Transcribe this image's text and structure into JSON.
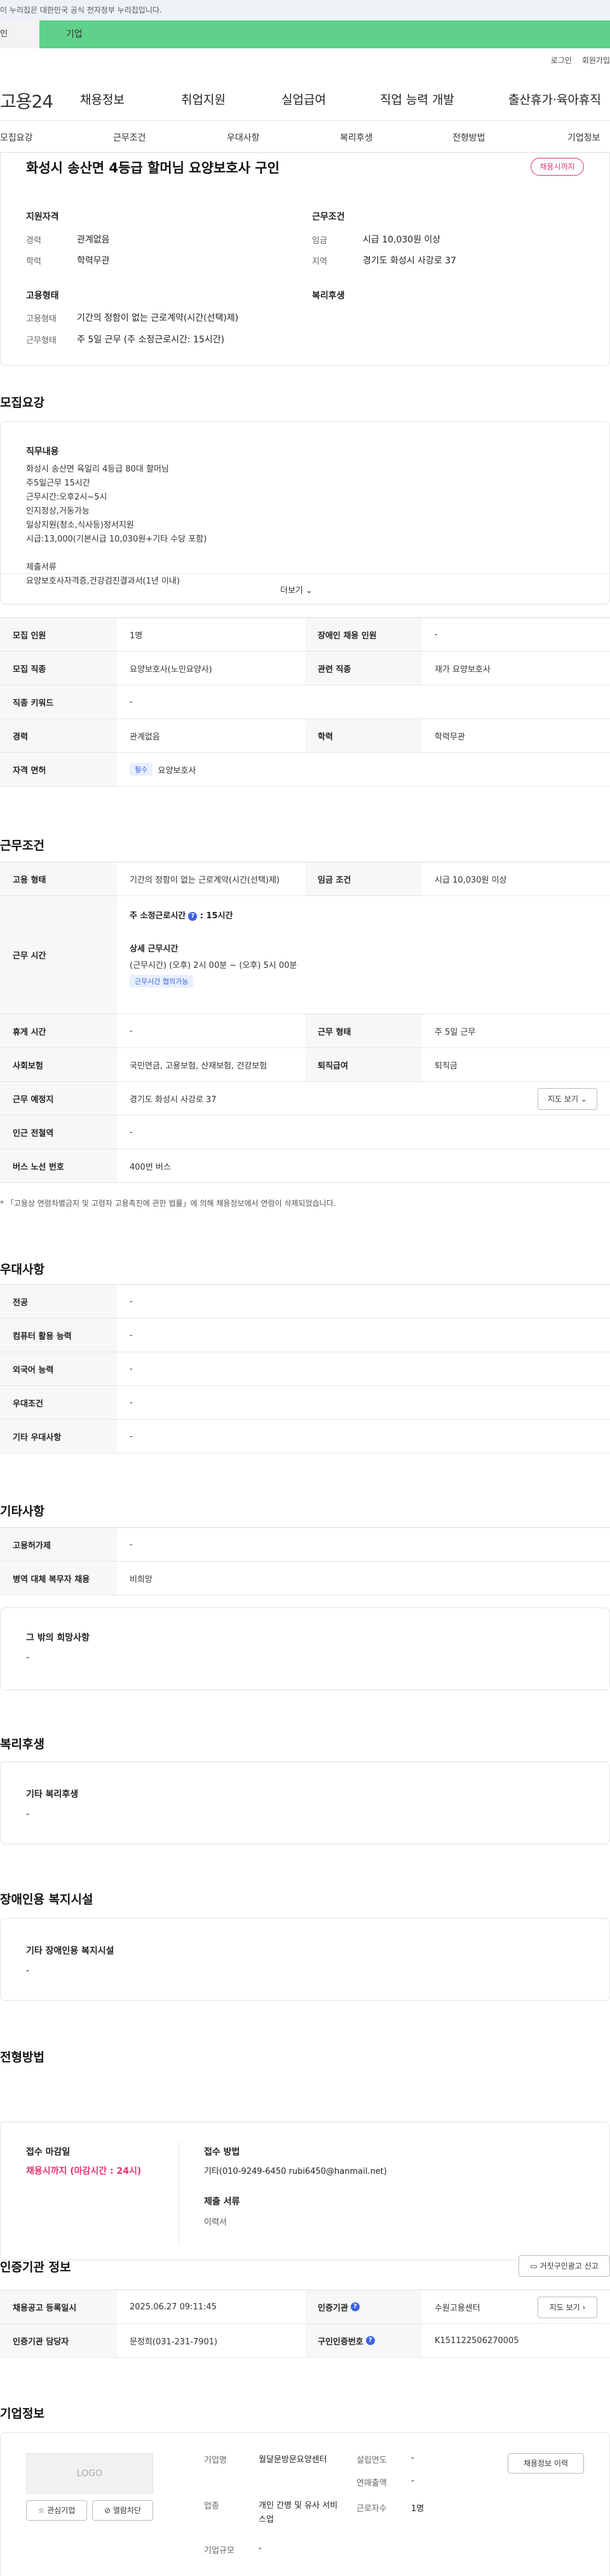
{
  "gov_banner": "이 누리집은 대한민국 공식 전자정부 누리집입니다.",
  "tabs": {
    "individual": "인",
    "company": "기업"
  },
  "util": {
    "login": "로그인",
    "join": "회원가입"
  },
  "logo": "고용24",
  "gnb": [
    "채용정보",
    "취업지원",
    "실업급여",
    "직업 능력 개발",
    "출산휴가·육아휴직"
  ],
  "snb": [
    "모집요강",
    "근무조건",
    "우대사항",
    "복리후생",
    "전형방법",
    "기업정보"
  ],
  "job": {
    "title": "화성시 송산면 4등급 할머님 요양보호사 구인",
    "deadline_badge": "채용시까지",
    "qual_title": "지원자격",
    "career_lbl": "경력",
    "career_val": "관계없음",
    "edu_lbl": "학력",
    "edu_val": "학력무관",
    "cond_title": "근무조건",
    "wage_lbl": "임금",
    "wage_val": "시급 10,030원 이상",
    "area_lbl": "지역",
    "area_val": "경기도 화성시 사강로 37",
    "emp_title": "고용형태",
    "emp_lbl": "고용형태",
    "emp_val": "기간의 정함이 없는 근로계약(시간(선택)제)",
    "work_lbl": "근무형태",
    "work_val": "주 5일 근무 (주 소정근로시간: 15시간)",
    "welfare_title": "복리후생"
  },
  "recruit": {
    "section": "모집요강",
    "duty_title": "직무내용",
    "duty_lines": [
      "화성시 송산면 육일리 4등급 80대 할머님",
      "주5일근무 15시간",
      "근무시간:오후2시~5시",
      "인지정상,거동가능",
      "일상지원(청소,식사등)정서지원",
      "시급:13,000(기본시급 10,030원+기타 수당 포함)",
      "",
      "제출서류",
      "요양보호사자격증,건강검진결과서(1년 이내)"
    ],
    "more": "더보기",
    "rows": [
      {
        "h1": "모집 인원",
        "v1": "1명",
        "h2": "장애인 채용 인원",
        "v2": "-"
      },
      {
        "h1": "모집 직종",
        "v1": "요양보호사(노인요양사)",
        "h2": "관련 직종",
        "v2": "재가 요양보호사"
      },
      {
        "h1": "직종 키워드",
        "v1": "-"
      },
      {
        "h1": "경력",
        "v1": "관계없음",
        "h2": "학력",
        "v2": "학력무관"
      },
      {
        "h1": "자격 면허",
        "tag": "필수",
        "v1": "요양보호사"
      }
    ]
  },
  "work": {
    "section": "근무조건",
    "type_h": "고용 형태",
    "type_v": "기간의 정함이 없는 근로계약(시간(선택)제)",
    "wage_h": "임금 조건",
    "wage_v": "시급 10,030원 이상",
    "time_h": "근무 시간",
    "weekly": "주 소정근로시간",
    "weekly_v": ": 15시간",
    "detail_title": "상세 근무시간",
    "detail_v": "(근무시간) (오후) 2시 00분 ~ (오후) 5시 00분",
    "detail_tag": "근무시간 협의가능",
    "rest_h": "휴게 시간",
    "rest_v": "-",
    "form_h": "근무 형태",
    "form_v": "주 5일 근무",
    "ins_h": "사회보험",
    "ins_v": "국민연금, 고용보험, 산재보험, 건강보험",
    "sev_h": "퇴직급여",
    "sev_v": "퇴직금",
    "loc_h": "근무 예정지",
    "loc_v": "경기도 화성시 사강로 37",
    "map_btn": "지도 보기",
    "sub_h": "인근 전철역",
    "sub_v": "-",
    "bus_h": "버스 노선 번호",
    "bus_v": "400번 버스",
    "note": "* 「고용상 연령차별금지 및 고령자 고용촉진에 관한 법률」에 의해 채용정보에서 연령이 삭제되었습니다."
  },
  "pref": {
    "section": "우대사항",
    "rows": [
      {
        "h": "전공",
        "v": "-"
      },
      {
        "h": "컴퓨터 활용 능력",
        "v": "-"
      },
      {
        "h": "외국어 능력",
        "v": "-"
      },
      {
        "h": "우대조건",
        "v": "-"
      },
      {
        "h": "기타 우대사항",
        "v": "-"
      }
    ]
  },
  "etc": {
    "section": "기타사항",
    "rows": [
      {
        "h": "고용허가제",
        "v": "-"
      },
      {
        "h": "병역 대체 복무자 채용",
        "v": "비희망"
      }
    ],
    "box_title": "그 밖의 희망사항",
    "box_v": "-"
  },
  "welfare": {
    "section": "복리후생",
    "box_title": "기타 복리후생",
    "box_v": "-"
  },
  "disab": {
    "section": "장애인용 복지시설",
    "box_title": "기타 장애인용 복지시설",
    "box_v": "-"
  },
  "screen": {
    "section": "전형방법",
    "deadline_title": "접수 마감일",
    "deadline_v": "채용시까지 (마감시간 : 24시)",
    "method_title": "접수 방법",
    "method_v": "기타(010-9249-6450 rubi6450@hanmail.net)",
    "docs_title": "제출 서류",
    "docs_v": "이력서"
  },
  "cert": {
    "section": "인증기관 정보",
    "report_btn": "거짓구인광고 신고",
    "reg_h": "채용공고 등록일시",
    "reg_v": "2025.06.27 09:11:45",
    "org_h": "인증기관",
    "org_v": "수원고용센터",
    "map_btn": "지도 보기",
    "mgr_h": "인증기관 담당자",
    "mgr_v": "문정희(031-231-7901)",
    "no_h": "구인인증번호",
    "no_v": "K151122506270005"
  },
  "company": {
    "section": "기업정보",
    "logo": "LOGO",
    "fav": "관심기업",
    "block": "열람차단",
    "name_h": "기업명",
    "name_v": "월달문방문요양센터",
    "found_h": "설립연도",
    "found_v": "-",
    "sales_h": "연매출액",
    "sales_v": "-",
    "ind_h": "업종",
    "ind_v": "개인 간병 및 유사 서비스업",
    "emp_h": "근로자수",
    "emp_v": "1명",
    "size_h": "기업규모",
    "size_v": "-",
    "history_btn": "채용정보 이력"
  }
}
